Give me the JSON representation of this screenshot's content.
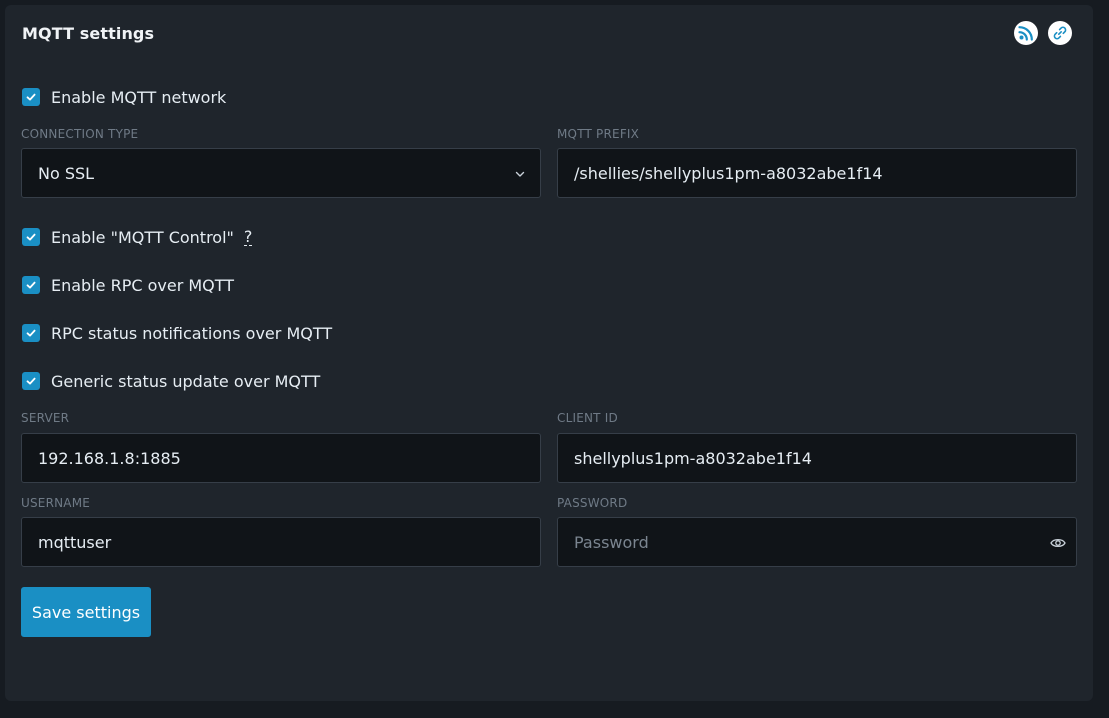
{
  "panel": {
    "title": "MQTT settings"
  },
  "header_icons": [
    {
      "name": "rss-icon"
    },
    {
      "name": "link-icon"
    }
  ],
  "enable_mqtt": {
    "label": "Enable MQTT network",
    "checked": true
  },
  "connection_type": {
    "label": "CONNECTION TYPE",
    "value": "No SSL"
  },
  "mqtt_prefix": {
    "label": "MQTT PREFIX",
    "value": "/shellies/shellyplus1pm-a8032abe1f14"
  },
  "checkboxes": {
    "mqtt_control": {
      "label": "Enable \"MQTT Control\"",
      "help": "?",
      "checked": true
    },
    "rpc_over_mqtt": {
      "label": "Enable RPC over MQTT",
      "checked": true
    },
    "rpc_status": {
      "label": "RPC status notifications over MQTT",
      "checked": true
    },
    "generic_status": {
      "label": "Generic status update over MQTT",
      "checked": true
    }
  },
  "server": {
    "label": "SERVER",
    "value": "192.168.1.8:1885"
  },
  "client_id": {
    "label": "CLIENT ID",
    "value": "shellyplus1pm-a8032abe1f14"
  },
  "username": {
    "label": "USERNAME",
    "value": "mqttuser"
  },
  "password": {
    "label": "PASSWORD",
    "value": "",
    "placeholder": "Password"
  },
  "save_button": {
    "label": "Save settings"
  },
  "colors": {
    "accent": "#1a8fc4",
    "panel_bg": "#1f252c",
    "page_bg": "#161b21",
    "input_bg": "#101418"
  }
}
